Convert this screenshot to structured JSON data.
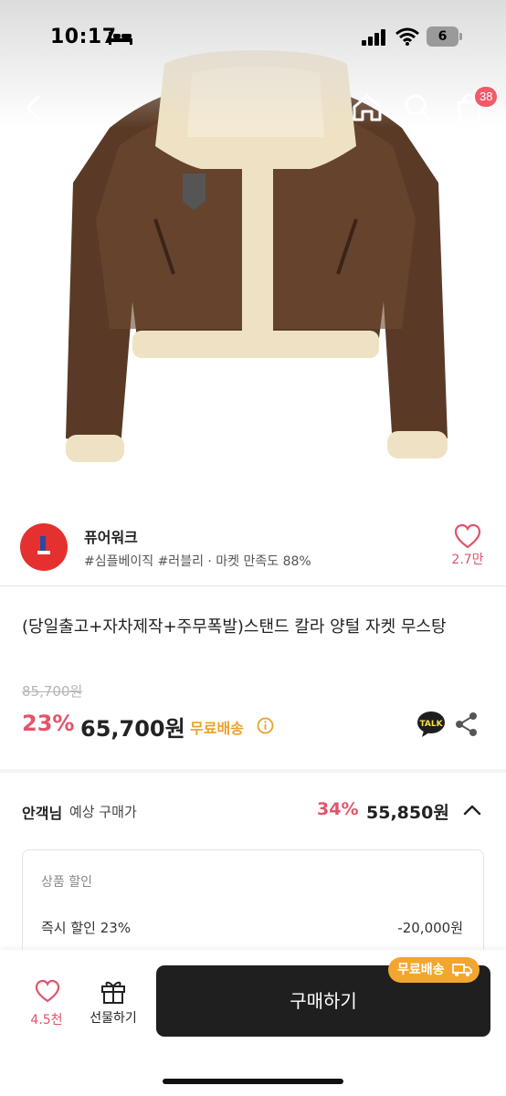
{
  "status_bar": {
    "time": "10:17",
    "battery": "6"
  },
  "nav": {
    "cart_count": "38"
  },
  "shop": {
    "name": "퓨어워크",
    "tags": "#심플베이직 #러블리 · 마켓 만족도 88%",
    "likes": "2.7만",
    "logo_color": "#e53030"
  },
  "product": {
    "title": "(당일출고+자차제작+주무폭발)스탠드 칼라 양털 자켓 무스탕",
    "original_price": "85,700원",
    "discount_rate": "23%",
    "price": "65,700원",
    "free_shipping": "무료배송"
  },
  "expected": {
    "who": "안객님",
    "label": "예상 구매가",
    "discount_rate": "34%",
    "price": "55,850원",
    "breakdown": {
      "heading": "상품 할인",
      "row_label": "즉시 할인 23%",
      "row_value": "-20,000원"
    }
  },
  "bottom_bar": {
    "like_count": "4.5천",
    "gift_label": "선물하기",
    "buy_label": "구매하기",
    "shipping_badge": "무료배송"
  },
  "colors": {
    "accent_pink": "#e2546a",
    "shipping_orange": "#f2a630",
    "buy_button": "#1f1f1f"
  },
  "icons": [
    "back-arrow-icon",
    "home-icon",
    "search-icon",
    "cart-icon",
    "heart-icon",
    "info-icon",
    "kakao-talk-icon",
    "share-icon",
    "chevron-up-icon",
    "gift-icon",
    "truck-icon"
  ]
}
